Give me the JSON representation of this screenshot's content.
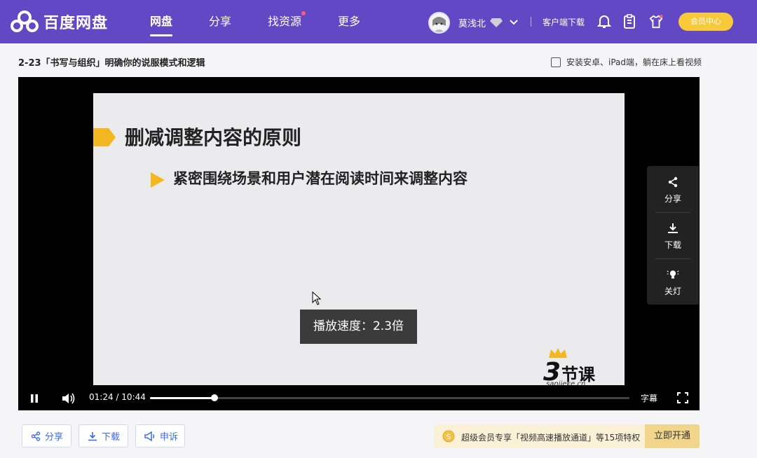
{
  "brand": {
    "name": "百度网盘"
  },
  "nav": [
    {
      "label": "网盘",
      "active": true
    },
    {
      "label": "分享",
      "active": false
    },
    {
      "label": "找资源",
      "active": false,
      "dot": true
    },
    {
      "label": "更多",
      "active": false
    }
  ],
  "user": {
    "name": "莫浅北"
  },
  "header": {
    "client_download": "客户端下载",
    "vip_center": "会员中心"
  },
  "page": {
    "title": "2-23「书写与组织」明确你的说服模式和逻辑",
    "install_hint": "安装安卓、iPad端，躺在床上看视频"
  },
  "slide": {
    "heading": "删减调整内容的原则",
    "bullet": "紧密围绕场景和用户潜在阅读时间来调整内容",
    "brand_num": "3",
    "brand_text": "节课",
    "brand_sub": "sanjieke.cn"
  },
  "player": {
    "speed_tip": "播放速度：2.3倍",
    "current_time": "01:24",
    "separator": "/",
    "duration": "10:44",
    "progress_fraction": 0.134,
    "subtitle_label": "字幕"
  },
  "side_panel": [
    {
      "label": "分享",
      "icon": "share-icon"
    },
    {
      "label": "下载",
      "icon": "download-icon"
    },
    {
      "label": "关灯",
      "icon": "lightbulb-icon"
    }
  ],
  "actions": {
    "share": "分享",
    "download": "下载",
    "report": "申诉"
  },
  "promo": {
    "coin": "S",
    "text": "超级会员专享「视频高速播放通道」等15项特权",
    "cta": "立即开通"
  },
  "colors": {
    "topbar": "#6248c4",
    "vip_button": "#f8c93a",
    "accent_blue": "#3b6ee8",
    "slide_marker": "#f3b820"
  }
}
